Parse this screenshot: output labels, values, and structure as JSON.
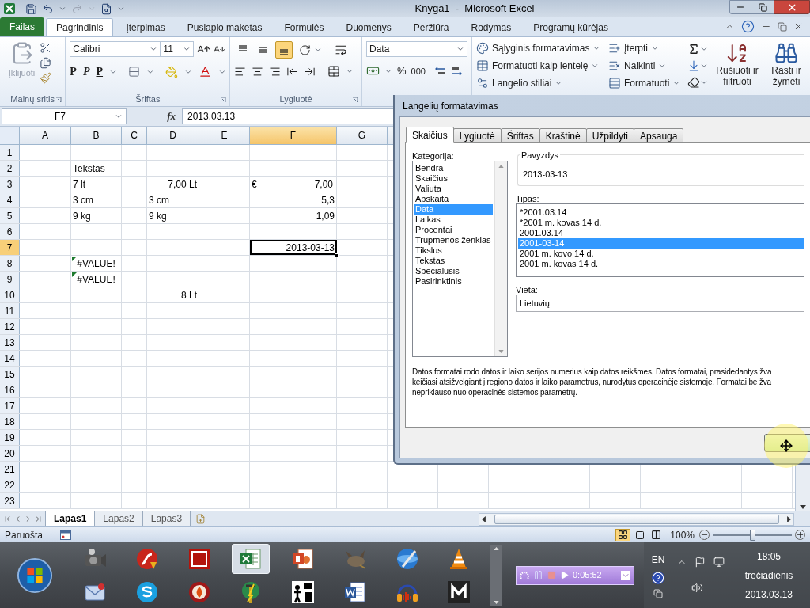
{
  "window": {
    "title": "Knyga1  -  Microsoft Excel"
  },
  "ribbon_tabs": [
    {
      "label": "Failas",
      "kind": "file",
      "selected": false
    },
    {
      "label": "Pagrindinis",
      "kind": "tab",
      "selected": true
    },
    {
      "label": "Įterpimas",
      "kind": "tab",
      "selected": false
    },
    {
      "label": "Puslapio maketas",
      "kind": "tab",
      "selected": false
    },
    {
      "label": "Formulės",
      "kind": "tab",
      "selected": false
    },
    {
      "label": "Duomenys",
      "kind": "tab",
      "selected": false
    },
    {
      "label": "Peržiūra",
      "kind": "tab",
      "selected": false
    },
    {
      "label": "Rodymas",
      "kind": "tab",
      "selected": false
    },
    {
      "label": "Programų kūrėjas",
      "kind": "tab",
      "selected": false
    }
  ],
  "clipboard": {
    "paste": "Įklijuoti",
    "disabled": true,
    "label": "Mainų sritis"
  },
  "font": {
    "name": "Calibri",
    "size": "11",
    "bold": "P",
    "italic": "P",
    "underline": "P",
    "label": "Šriftas"
  },
  "alignment": {
    "vertical": [
      {
        "kind": "top",
        "selected": false
      },
      {
        "kind": "middle",
        "selected": false
      },
      {
        "kind": "bottom",
        "selected": true
      }
    ],
    "label": "Lygiuotė"
  },
  "number": {
    "format": "Data",
    "percent": "%",
    "thousands": "000"
  },
  "styles": [
    "Sąlyginis formatavimas",
    "Formatuoti kaip lentelę",
    "Langelio stiliai"
  ],
  "cells_group": [
    "Įterpti",
    "Naikinti",
    "Formatuoti"
  ],
  "editing": {
    "sort": "Rūšiuoti ir filtruoti",
    "find": "Rasti ir žymėti"
  },
  "formula_bar": {
    "cell": "F7",
    "fx": "fx",
    "value": "2013.03.13"
  },
  "sheet": {
    "columns": [
      {
        "label": "A",
        "selected": false
      },
      {
        "label": "B",
        "selected": false
      },
      {
        "label": "C",
        "selected": false
      },
      {
        "label": "D",
        "selected": false
      },
      {
        "label": "E",
        "selected": false
      },
      {
        "label": "F",
        "selected": true
      },
      {
        "label": "G",
        "selected": false
      }
    ],
    "rows": [
      {
        "header": "1",
        "selected": false
      },
      {
        "header": "2",
        "selected": false,
        "cells": [
          {},
          {
            "text": "Tekstas",
            "right_aligned": false,
            "error": false,
            "selected": false
          },
          {},
          {},
          {},
          {},
          {}
        ]
      },
      {
        "header": "3",
        "selected": false,
        "cells": [
          {},
          {
            "text": "7 lt",
            "right_aligned": false,
            "error": false,
            "selected": false
          },
          {},
          {
            "text": "7,00 Lt",
            "right_aligned": true,
            "error": false,
            "selected": false
          },
          {},
          {
            "kind": "accounting",
            "symbol": "€",
            "text": "7,00",
            "error": false,
            "selected": false
          },
          {}
        ]
      },
      {
        "header": "4",
        "selected": false,
        "cells": [
          {},
          {
            "text": "3 cm",
            "right_aligned": false,
            "error": false,
            "selected": false
          },
          {},
          {
            "text": "3 cm",
            "right_aligned": false,
            "error": false,
            "selected": false
          },
          {},
          {
            "text": "5,3",
            "right_aligned": true,
            "error": false,
            "selected": false
          },
          {}
        ]
      },
      {
        "header": "5",
        "selected": false,
        "cells": [
          {},
          {
            "text": "9 kg",
            "right_aligned": false,
            "error": false,
            "selected": false
          },
          {},
          {
            "text": "9 kg",
            "right_aligned": false,
            "error": false,
            "selected": false
          },
          {},
          {
            "text": "1,09",
            "right_aligned": true,
            "error": false,
            "selected": false
          },
          {}
        ]
      },
      {
        "header": "6",
        "selected": false
      },
      {
        "header": "7",
        "selected": true,
        "cells": [
          {},
          {},
          {},
          {},
          {},
          {
            "text": "2013-03-13",
            "right_aligned": true,
            "error": false,
            "selected": true
          },
          {}
        ]
      },
      {
        "header": "8",
        "selected": false,
        "cells": [
          {},
          {
            "text": "#VALUE!",
            "error": true,
            "selected": false
          },
          {},
          {},
          {},
          {},
          {}
        ]
      },
      {
        "header": "9",
        "selected": false,
        "cells": [
          {},
          {
            "text": "#VALUE!",
            "error": true,
            "selected": false
          },
          {},
          {},
          {},
          {},
          {}
        ]
      },
      {
        "header": "10",
        "selected": false,
        "cells": [
          {},
          {},
          {},
          {
            "text": "8 Lt",
            "right_aligned": true,
            "error": false,
            "selected": false
          },
          {},
          {},
          {}
        ]
      },
      {
        "header": "11",
        "selected": false
      },
      {
        "header": "12",
        "selected": false
      },
      {
        "header": "13",
        "selected": false
      },
      {
        "header": "14",
        "selected": false
      },
      {
        "header": "15",
        "selected": false
      },
      {
        "header": "16",
        "selected": false
      },
      {
        "header": "17",
        "selected": false
      },
      {
        "header": "18",
        "selected": false
      },
      {
        "header": "19",
        "selected": false
      },
      {
        "header": "20",
        "selected": false
      },
      {
        "header": "21",
        "selected": false
      },
      {
        "header": "22",
        "selected": false
      },
      {
        "header": "23",
        "selected": false
      }
    ]
  },
  "sheet_tabs": [
    {
      "label": "Lapas1",
      "selected": true
    },
    {
      "label": "Lapas2",
      "selected": false
    },
    {
      "label": "Lapas3",
      "selected": false
    }
  ],
  "status_bar": {
    "text": "Paruošta",
    "views": [
      {
        "kind": "normal",
        "selected": true
      },
      {
        "kind": "page_layout",
        "selected": false
      },
      {
        "kind": "page_break",
        "selected": false
      }
    ],
    "zoom": {
      "label": "100%",
      "level": 0.5
    }
  },
  "dialog": {
    "title": "Langelių formatavimas",
    "tabs": [
      {
        "label": "Skaičius",
        "selected": true
      },
      {
        "label": "Lygiuotė",
        "selected": false
      },
      {
        "label": "Šriftas",
        "selected": false
      },
      {
        "label": "Kraštinė",
        "selected": false
      },
      {
        "label": "Užpildyti",
        "selected": false
      },
      {
        "label": "Apsauga",
        "selected": false
      }
    ],
    "category_label": "Kategorija:",
    "categories": [
      {
        "label": "Bendra",
        "selected": false
      },
      {
        "label": "Skaičius",
        "selected": false
      },
      {
        "label": "Valiuta",
        "selected": false
      },
      {
        "label": "Apskaita",
        "selected": false
      },
      {
        "label": "Data",
        "selected": true
      },
      {
        "label": "Laikas",
        "selected": false
      },
      {
        "label": "Procentai",
        "selected": false
      },
      {
        "label": "Trupmenos ženklas",
        "selected": false
      },
      {
        "label": "Tikslus",
        "selected": false
      },
      {
        "label": "Tekstas",
        "selected": false
      },
      {
        "label": "Specialusis",
        "selected": false
      },
      {
        "label": "Pasirinktinis",
        "selected": false
      }
    ],
    "sample": {
      "label": "Pavyzdys",
      "value": "2013-03-13"
    },
    "type_label": "Tipas:",
    "types": [
      {
        "label": "*2001.03.14",
        "selected": false
      },
      {
        "label": "*2001 m. kovas 14 d.",
        "selected": false
      },
      {
        "label": "2001.03.14",
        "selected": false
      },
      {
        "label": "2001-03-14",
        "selected": true
      },
      {
        "label": "2001 m. kovo 14 d.",
        "selected": false
      },
      {
        "label": "2001 m. kovas 14 d.",
        "selected": false
      }
    ],
    "locale_label": "Vieta:",
    "locale": "Lietuvių",
    "description_lines": [
      "Datos formatai rodo datos ir laiko serijos numerius kaip datos reikšmes. Datos formatai, prasidedantys žva",
      "keičiasi atsižvelgiant į regiono datos ir laiko parametrus, nurodytus operacinėje sistemoje. Formatai be žva",
      "nepriklauso nuo operacinės sistemos parametrų."
    ]
  },
  "taskbar": {
    "apps": [
      {
        "kind": "camera",
        "active": false
      },
      {
        "kind": "orb",
        "active": false
      },
      {
        "kind": "tile",
        "active": false
      },
      {
        "kind": "spreadsheet",
        "active": true
      },
      {
        "kind": "slides",
        "active": false
      },
      {
        "kind": "mascot",
        "active": false
      },
      {
        "kind": "globe",
        "active": false
      },
      {
        "kind": "cone",
        "active": false
      },
      {
        "kind": "envelope",
        "active": false
      },
      {
        "kind": "chat",
        "active": false
      },
      {
        "kind": "flame",
        "active": false
      },
      {
        "kind": "tool",
        "active": false
      },
      {
        "kind": "figure",
        "active": false
      },
      {
        "kind": "document",
        "active": false
      },
      {
        "kind": "headphones",
        "active": false
      },
      {
        "kind": "dark_tile",
        "active": false
      }
    ],
    "recorder": {
      "elapsed": "0:05:52"
    },
    "language": "EN",
    "clock": {
      "time": "18:05",
      "day": "trečiadienis",
      "date": "2013.03.13"
    }
  }
}
